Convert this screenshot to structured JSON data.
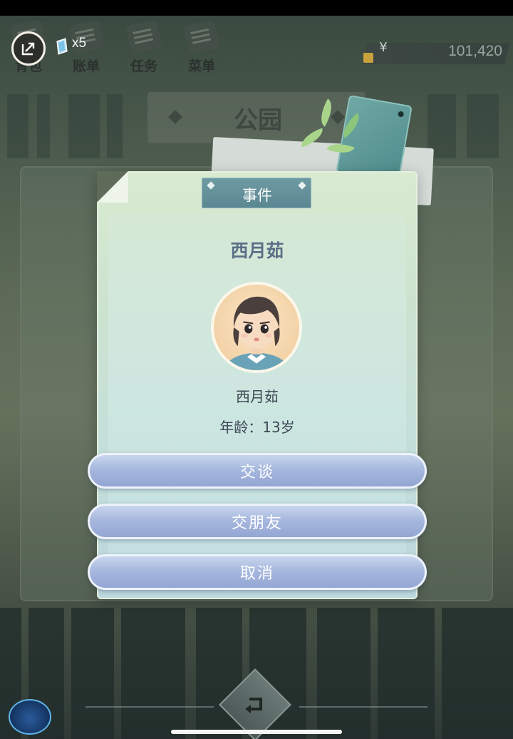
{
  "top_nav": {
    "gem_count": "x5",
    "items": [
      {
        "label": "背包",
        "icon": "bag-icon"
      },
      {
        "label": "账单",
        "icon": "bill-icon"
      },
      {
        "label": "任务",
        "icon": "task-icon"
      },
      {
        "label": "菜单",
        "icon": "menu-icon"
      }
    ],
    "currency_symbol": "¥",
    "money": "101,420"
  },
  "location": {
    "title": "公园"
  },
  "dialog": {
    "header": "事件",
    "npc_title": "西月茹",
    "npc_name": "西月茹",
    "npc_age": "年龄：13岁",
    "actions": [
      {
        "label": "交谈"
      },
      {
        "label": "交朋友"
      },
      {
        "label": "取消"
      }
    ]
  },
  "colors": {
    "button_fill": "#a7b8de",
    "dialog_fill": "#cde3cf",
    "event_tag": "#5a8792",
    "name_text": "#5b6f86"
  }
}
